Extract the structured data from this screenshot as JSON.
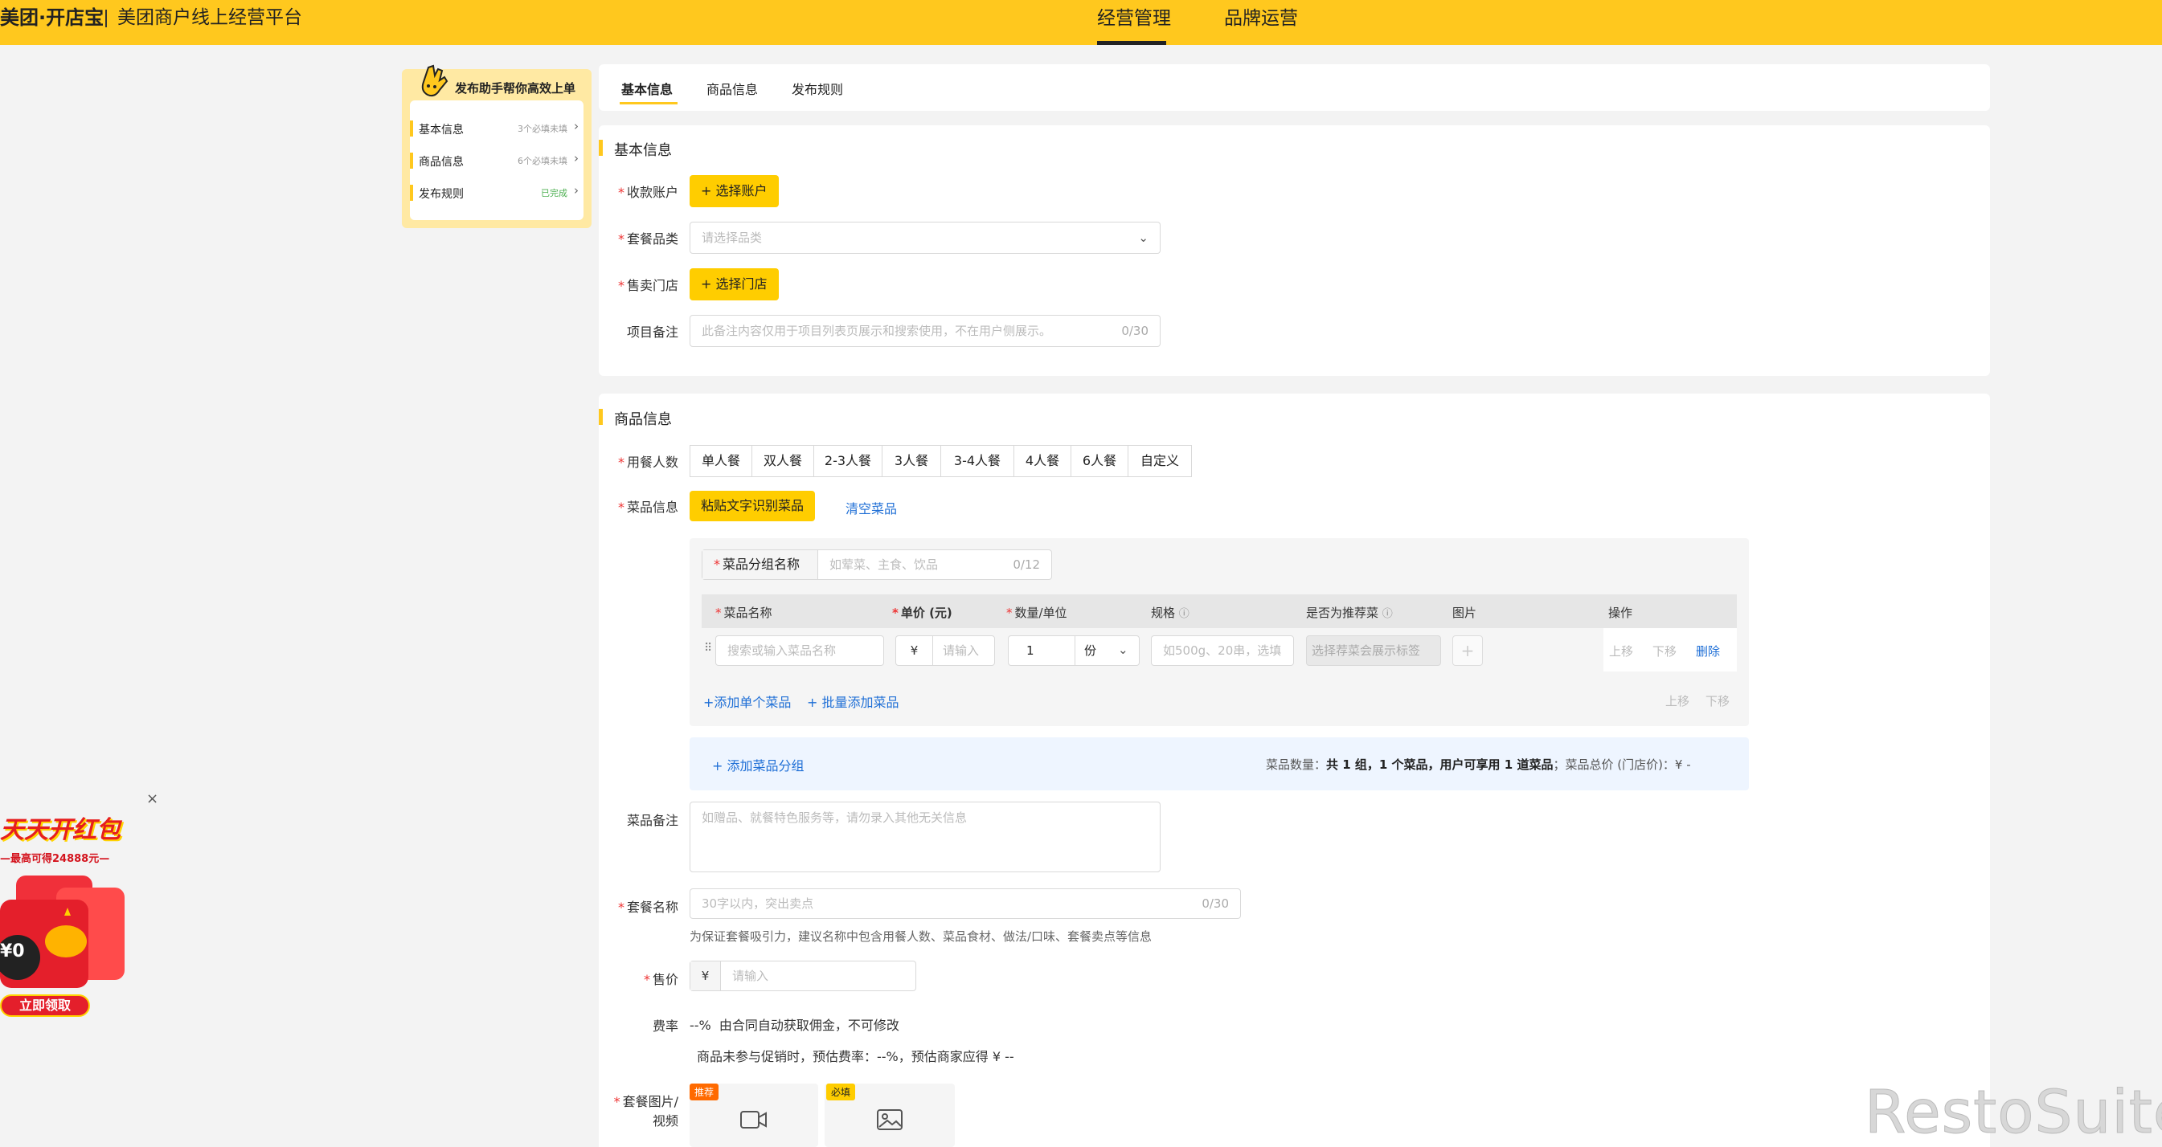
{
  "header": {
    "brand": "美团·开店宝",
    "subtitle": "美团商户线上经营平台",
    "nav": [
      "经营管理",
      "品牌运营"
    ]
  },
  "helper": {
    "title": "发布助手帮你高效上单",
    "items": [
      {
        "label": "基本信息",
        "status": "3个必填未填"
      },
      {
        "label": "商品信息",
        "status": "6个必填未填"
      },
      {
        "label": "发布规则",
        "status": "已完成"
      }
    ]
  },
  "tabs": [
    "基本信息",
    "商品信息",
    "发布规则"
  ],
  "basic": {
    "title": "基本信息",
    "account_label": "收款账户",
    "account_btn": "+ 选择账户",
    "category_label": "套餐品类",
    "category_placeholder": "请选择品类",
    "store_label": "售卖门店",
    "store_btn": "+ 选择门店",
    "note_label": "项目备注",
    "note_placeholder": "此备注内容仅用于项目列表页展示和搜索使用，不在用户侧展示。",
    "note_count": "0/30"
  },
  "goods": {
    "title": "商品信息",
    "diners_label": "用餐人数",
    "diners": [
      "单人餐",
      "双人餐",
      "2-3人餐",
      "3人餐",
      "3-4人餐",
      "4人餐",
      "6人餐",
      "自定义"
    ],
    "dish_label": "菜品信息",
    "paste_btn": "粘贴文字识别菜品",
    "clear_link": "清空菜品",
    "group_name_label": "菜品分组名称",
    "group_name_placeholder": "如荤菜、主食、饮品",
    "group_name_count": "0/12",
    "cols": [
      "菜品名称",
      "单价 (元)",
      "数量/单位",
      "规格",
      "是否为推荐菜",
      "图片",
      "操作"
    ],
    "row": {
      "name_placeholder": "搜索或输入菜品名称",
      "currency": "¥",
      "price_placeholder": "请输入",
      "qty": "1",
      "unit": "份",
      "spec_placeholder": "如500g、20串，选填",
      "rec_placeholder": "选择荐菜会展示标签",
      "plus": "+",
      "up": "上移",
      "down": "下移",
      "del": "删除"
    },
    "add_single": "+添加单个菜品",
    "add_batch": "+ 批量添加菜品",
    "group_up": "上移",
    "group_down": "下移",
    "add_group": "+ 添加菜品分组",
    "summary_prefix": "菜品数量：",
    "summary_bold": "共 1 组，1 个菜品，用户可享用 1 道菜品",
    "summary_suffix": "；菜品总价 (门店价)：¥ -",
    "memo_label": "菜品备注",
    "memo_placeholder": "如赠品、就餐特色服务等，请勿录入其他无关信息",
    "pkg_label": "套餐名称",
    "pkg_placeholder": "30字以内，突出卖点",
    "pkg_count": "0/30",
    "pkg_hint": "为保证套餐吸引力，建议名称中包含用餐人数、菜品食材、做法/口味、套餐卖点等信息",
    "price_label": "售价",
    "price_currency": "¥",
    "price_placeholder": "请输入",
    "rate_label": "费率",
    "rate_text": "--%  由合同自动获取佣金，不可修改",
    "rate_hint": "商品未参与促销时，预估费率：--%，预估商家应得 ¥ --",
    "media_label_1": "套餐图片/",
    "media_label_2": "视频",
    "media_tag1": "推荐",
    "media_tag2": "必填"
  },
  "promo": {
    "title": "天天开红包",
    "line1": "—最高可得24888元—",
    "cta": "立即领取",
    "close": "×",
    "coin": "¥0"
  },
  "watermark": "RestoSuite"
}
